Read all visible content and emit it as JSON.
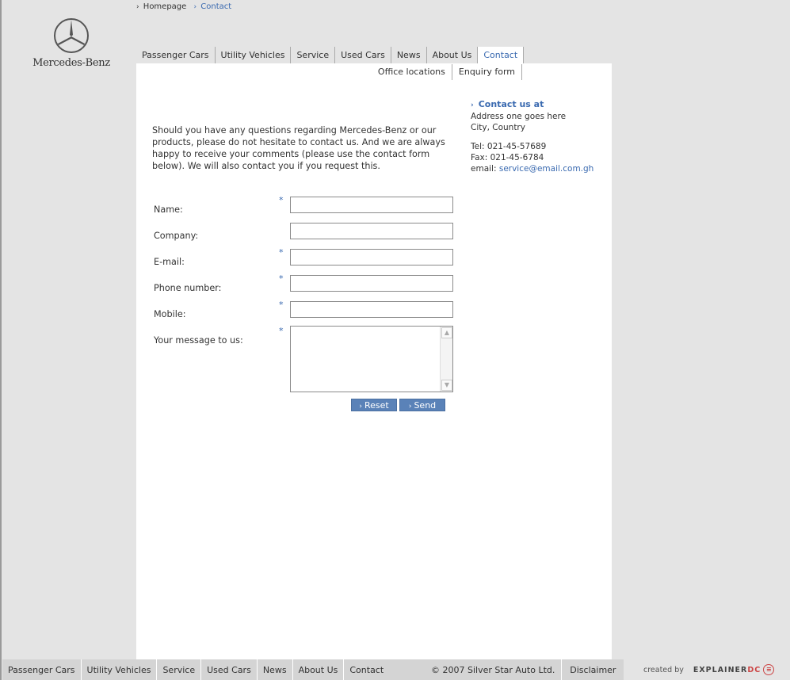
{
  "brand": {
    "name": "Mercedes-Benz"
  },
  "breadcrumb": [
    {
      "label": "Homepage",
      "active": false
    },
    {
      "label": "Contact",
      "active": true
    }
  ],
  "nav": {
    "tabs": [
      "Passenger Cars",
      "Utility Vehicles",
      "Service",
      "Used Cars",
      "News",
      "About Us",
      "Contact"
    ],
    "active": "Contact"
  },
  "subnav": [
    "Office locations",
    "Enquiry form"
  ],
  "intro": "Should you have any questions regarding Mercedes-Benz or our products, please do not hesitate to contact us. And we are always happy to receive your comments (please use the contact form below). We will also contact you if you request this.",
  "form": {
    "required_mark": "*",
    "fields": [
      {
        "label": "Name:",
        "required": true
      },
      {
        "label": "Company:",
        "required": false
      },
      {
        "label": "E-mail:",
        "required": true
      },
      {
        "label": "Phone number:",
        "required": true
      },
      {
        "label": "Mobile:",
        "required": true
      }
    ],
    "message_label": "Your message to us:",
    "reset_label": "Reset",
    "send_label": "Send"
  },
  "contact": {
    "heading": "Contact us at",
    "address1": "Address one goes here",
    "address2": "City, Country",
    "tel": "Tel: 021-45-57689",
    "fax": "Fax: 021-45-6784",
    "email_label": "email:",
    "email": "service@email.com.gh"
  },
  "footer": {
    "links": [
      "Passenger Cars",
      "Utility Vehicles",
      "Service",
      "Used Cars",
      "News",
      "About Us",
      "Contact"
    ],
    "copyright": "© 2007 Silver Star Auto Ltd.",
    "disclaimer": "Disclaimer"
  },
  "credit": {
    "text": "created by",
    "brand_main": "EXPLAINER",
    "brand_suffix": "DC"
  },
  "colors": {
    "accent": "#3a6ab0",
    "button": "#5a82b8",
    "background": "#e4e4e4"
  },
  "icons": {
    "logo": "mercedes-star-icon",
    "arrow": "chevron-right-icon"
  }
}
